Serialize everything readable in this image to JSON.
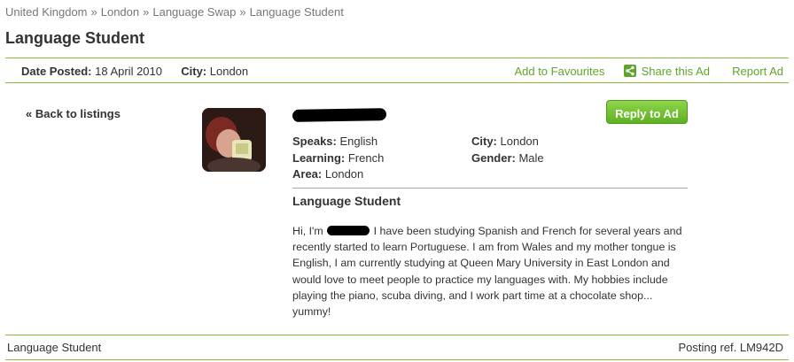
{
  "breadcrumb": {
    "items": [
      "United Kingdom",
      "London",
      "Language Swap",
      "Language Student"
    ],
    "separator": "»"
  },
  "page_title": "Language Student",
  "meta": {
    "date_label": "Date Posted:",
    "date_value": "18 April 2010",
    "city_label": "City:",
    "city_value": "London",
    "add_to_favourites": "Add to Favourites",
    "share_this_ad": "Share this Ad",
    "report_ad": "Report Ad"
  },
  "back_link": "« Back to listings",
  "reply_button": "Reply to Ad",
  "details": {
    "speaks_label": "Speaks:",
    "speaks_value": "English",
    "learning_label": "Learning:",
    "learning_value": "French",
    "area_label": "Area:",
    "area_value": "London",
    "city_label": "City:",
    "city_value": "London",
    "gender_label": "Gender:",
    "gender_value": "Male"
  },
  "ad": {
    "title": "Language Student",
    "body_start": "Hi, I'm",
    "body_rest": " I have been studying Spanish and French for several years and recently started to learn Portuguese. I am from Wales and my mother tongue is English, I am currently studying at Queen Mary University in East London and would love to meet people to practice my languages with. My hobbies include playing the piano, scuba diving, and I work part time at a chocolate shop... yummy!"
  },
  "footer": {
    "left": "Language Student",
    "posting_ref": "Posting ref. LM942D"
  },
  "colors": {
    "accent_green": "#5ea52c",
    "rule_green": "#8bbd3c"
  }
}
